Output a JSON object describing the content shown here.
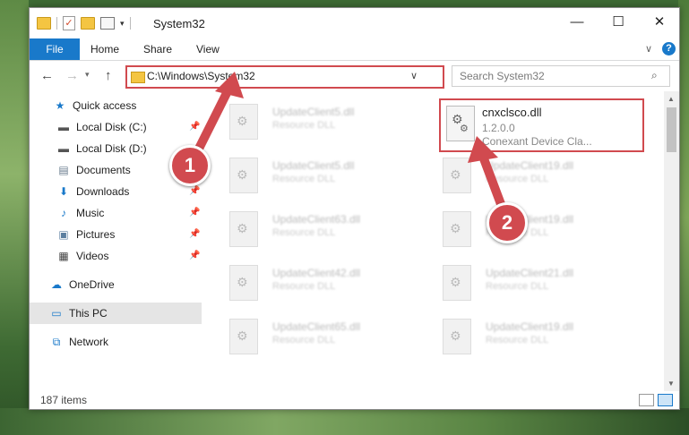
{
  "window": {
    "title": "System32"
  },
  "ribbon": {
    "file": "File",
    "home": "Home",
    "share": "Share",
    "view": "View"
  },
  "address": {
    "path": "C:\\Windows\\System32",
    "search_placeholder": "Search System32"
  },
  "nav": [
    {
      "label": "Quick access"
    },
    {
      "label": "Local Disk (C:)"
    },
    {
      "label": "Local Disk (D:)"
    },
    {
      "label": "Documents"
    },
    {
      "label": "Downloads"
    },
    {
      "label": "Music"
    },
    {
      "label": "Pictures"
    },
    {
      "label": "Videos"
    },
    {
      "label": "OneDrive"
    },
    {
      "label": "This PC"
    },
    {
      "label": "Network"
    }
  ],
  "files": [
    {
      "name": "UpdateClient5.dll",
      "type": "Resource DLL"
    },
    {
      "name": "UpdateClient5.dll",
      "type": "Resource DLL"
    },
    {
      "name": "UpdateClient19.dll",
      "type": "Resource DLL"
    },
    {
      "name": "UpdateClient63.dll",
      "type": "Resource DLL"
    },
    {
      "name": "UpdateClient19.dll",
      "type": "Resource DLL"
    },
    {
      "name": "UpdateClient42.dll",
      "type": "Resource DLL"
    },
    {
      "name": "UpdateClient21.dll",
      "type": "Resource DLL"
    },
    {
      "name": "UpdateClient65.dll",
      "type": "Resource DLL"
    },
    {
      "name": "UpdateClient19.dll",
      "type": "Resource DLL"
    }
  ],
  "highlight": {
    "name": "cnxclsco.dll",
    "version": "1.2.0.0",
    "description": "Conexant Device Cla..."
  },
  "status": {
    "count": "187 items"
  },
  "callouts": {
    "one": "1",
    "two": "2"
  },
  "colors": {
    "accent": "#1979ca",
    "callout": "#d14a4f"
  }
}
